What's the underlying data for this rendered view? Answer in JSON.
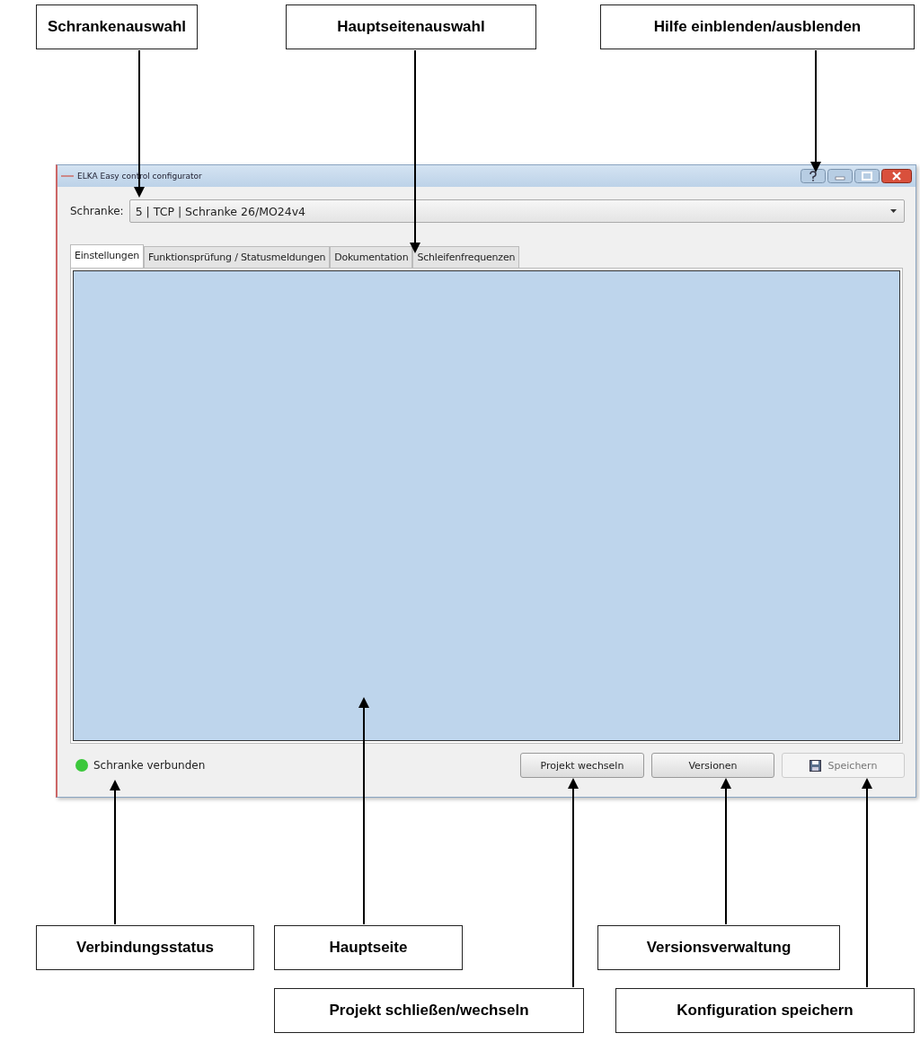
{
  "callouts_top": [
    "Schrankenauswahl",
    "Hauptseitenauswahl",
    "Hilfe einblenden/ausblenden"
  ],
  "window": {
    "title": "ELKA Easy control configurator"
  },
  "schranke": {
    "label": "Schranke:",
    "value": "5 | TCP | Schranke 26/MO24v4"
  },
  "tabs": [
    {
      "label": "Einstellungen",
      "selected": true
    },
    {
      "label": "Funktionsprüfung / Statusmeldungen",
      "selected": false
    },
    {
      "label": "Dokumentation",
      "selected": false
    },
    {
      "label": "Schleifenfrequenzen",
      "selected": false
    }
  ],
  "status": {
    "text": "Schranke verbunden",
    "color": "#3cc83c"
  },
  "buttons": [
    {
      "label": "Projekt wechseln",
      "disabled": false,
      "kind": "text"
    },
    {
      "label": "Versionen",
      "disabled": false,
      "kind": "text"
    },
    {
      "label": "Speichern",
      "disabled": true,
      "kind": "save"
    }
  ],
  "callouts_bottom": [
    "Verbindungsstatus",
    "Hauptseite",
    "Versionsverwaltung",
    "Projekt schließen/wechseln",
    "Konfiguration speichern"
  ]
}
